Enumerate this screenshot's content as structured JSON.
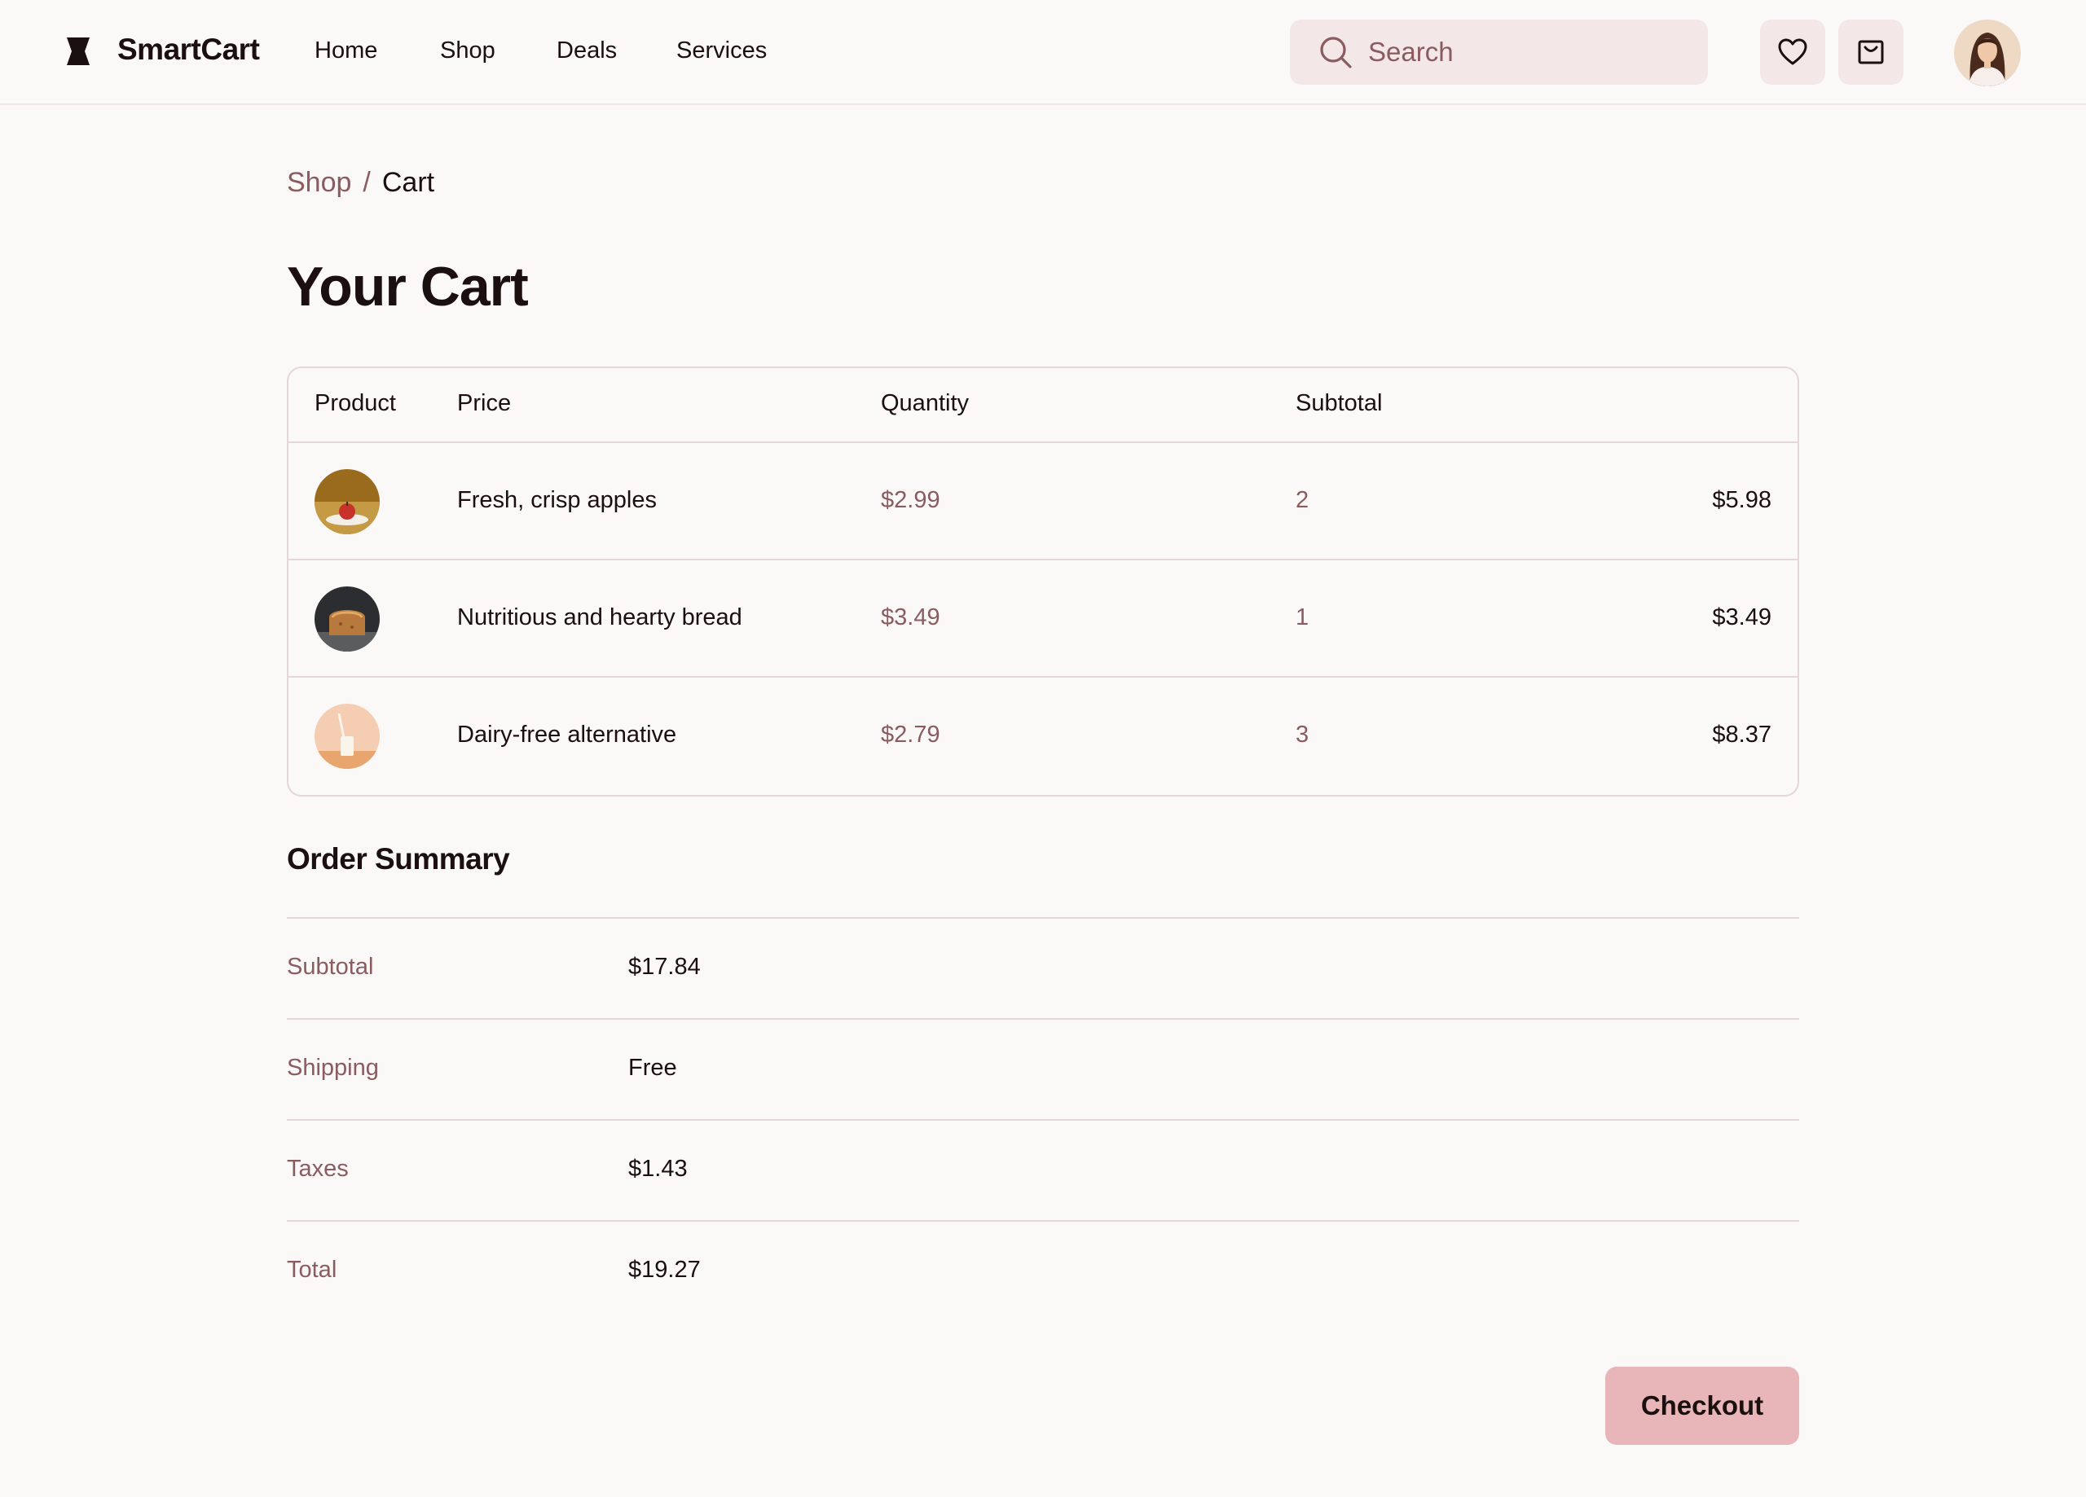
{
  "header": {
    "brand": "SmartCart",
    "nav": [
      "Home",
      "Shop",
      "Deals",
      "Services"
    ],
    "search_placeholder": "Search",
    "icons": [
      "logo-icon",
      "search-icon",
      "heart-icon",
      "cart-icon",
      "user-avatar"
    ]
  },
  "breadcrumb": {
    "parent": "Shop",
    "separator": "/",
    "current": "Cart"
  },
  "page_title": "Your Cart",
  "cart": {
    "columns": [
      "Product",
      "Price",
      "Quantity",
      "Subtotal"
    ],
    "items": [
      {
        "name": "Fresh, crisp apples",
        "price": "$2.99",
        "quantity": "2",
        "subtotal": "$5.98"
      },
      {
        "name": "Nutritious and hearty bread",
        "price": "$3.49",
        "quantity": "1",
        "subtotal": "$3.49"
      },
      {
        "name": "Dairy-free alternative",
        "price": "$2.79",
        "quantity": "3",
        "subtotal": "$8.37"
      }
    ]
  },
  "summary": {
    "title": "Order Summary",
    "rows": [
      {
        "label": "Subtotal",
        "value": "$17.84"
      },
      {
        "label": "Shipping",
        "value": "Free"
      },
      {
        "label": "Taxes",
        "value": "$1.43"
      },
      {
        "label": "Total",
        "value": "$19.27"
      }
    ]
  },
  "checkout_label": "Checkout",
  "colors": {
    "accent": "#e8b6b9",
    "muted_text": "#8a5b5f",
    "search_bg": "#f3e7e8",
    "border": "#e3d7d8"
  }
}
